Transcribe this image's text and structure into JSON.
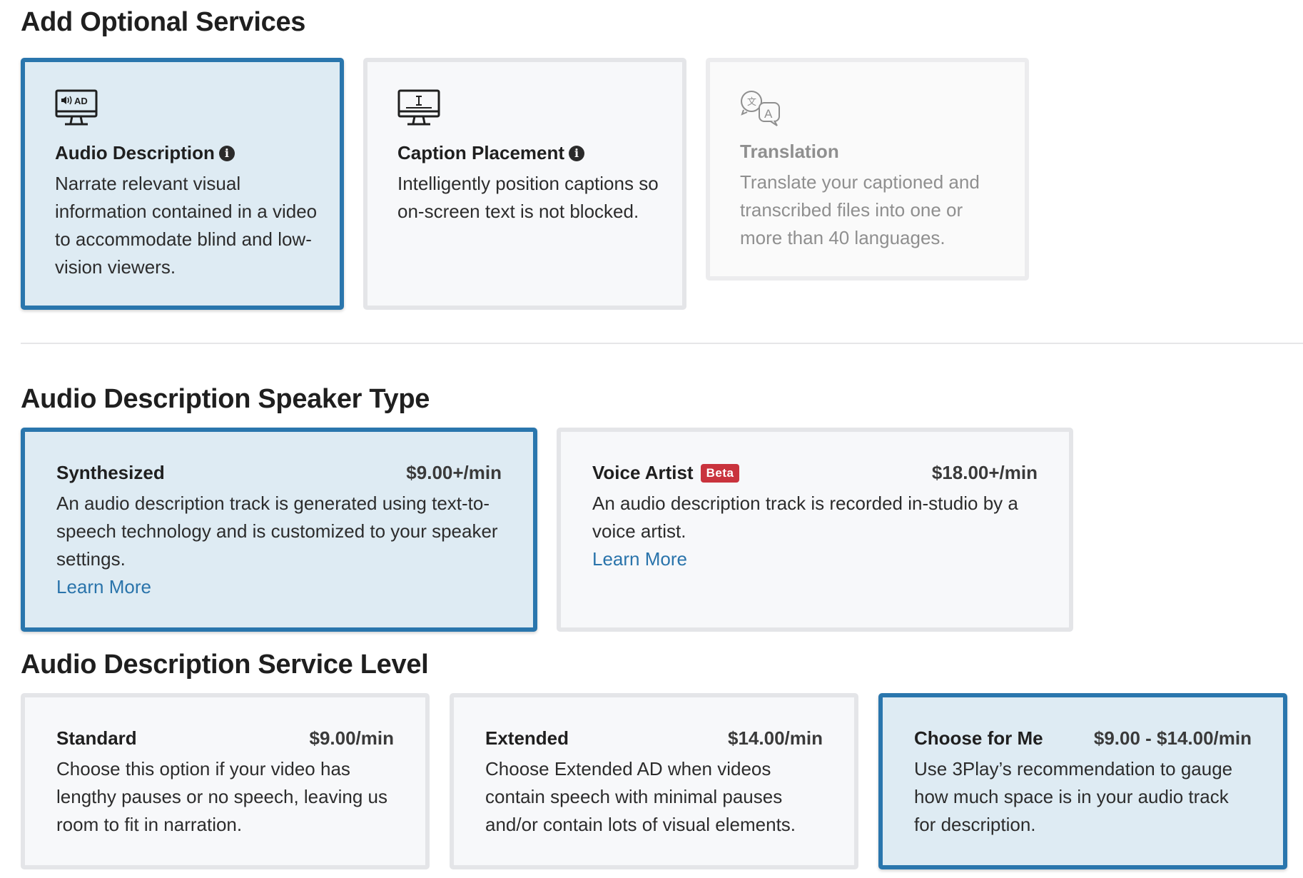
{
  "optional_services": {
    "heading": "Add Optional Services",
    "cards": [
      {
        "title": "Audio Description",
        "description": "Narrate relevant visual information contained in a video to accommodate blind and low-vision viewers.",
        "icon": "monitor-ad-icon",
        "state": "selected"
      },
      {
        "title": "Caption Placement",
        "description": "Intelligently position captions so on-screen text is not blocked.",
        "icon": "monitor-caption-icon",
        "state": "default"
      },
      {
        "title": "Translation",
        "description": "Translate your captioned and transcribed files into one or more than 40 languages.",
        "icon": "translate-icon",
        "state": "disabled"
      }
    ],
    "ad_icon_text": "AD"
  },
  "speaker_type": {
    "heading": "Audio Description Speaker Type",
    "cards": [
      {
        "title": "Synthesized",
        "price": "$9.00+/min",
        "description": "An audio description track is generated using text-to-speech technology and is customized to your speaker settings.",
        "link": "Learn More",
        "state": "selected"
      },
      {
        "title": "Voice Artist",
        "badge": "Beta",
        "price": "$18.00+/min",
        "description": "An audio description track is recorded in-studio by a voice artist.",
        "link": "Learn More",
        "state": "default"
      }
    ]
  },
  "service_level": {
    "heading": "Audio Description Service Level",
    "cards": [
      {
        "title": "Standard",
        "price": "$9.00/min",
        "description": "Choose this option if your video has lengthy pauses or no speech, leaving us room to fit in narration.",
        "state": "default"
      },
      {
        "title": "Extended",
        "price": "$14.00/min",
        "description": "Choose Extended AD when videos contain speech with minimal pauses and/or contain lots of visual elements.",
        "state": "default"
      },
      {
        "title": "Choose for Me",
        "price": "$9.00 - $14.00/min",
        "description": "Use 3Play’s recommendation to gauge how much space is in your audio track for description.",
        "state": "selected"
      }
    ]
  },
  "colors": {
    "selected_border": "#2a76ad",
    "selected_bg": "#deebf3",
    "link": "#2a74ab",
    "badge": "#c9333d"
  }
}
